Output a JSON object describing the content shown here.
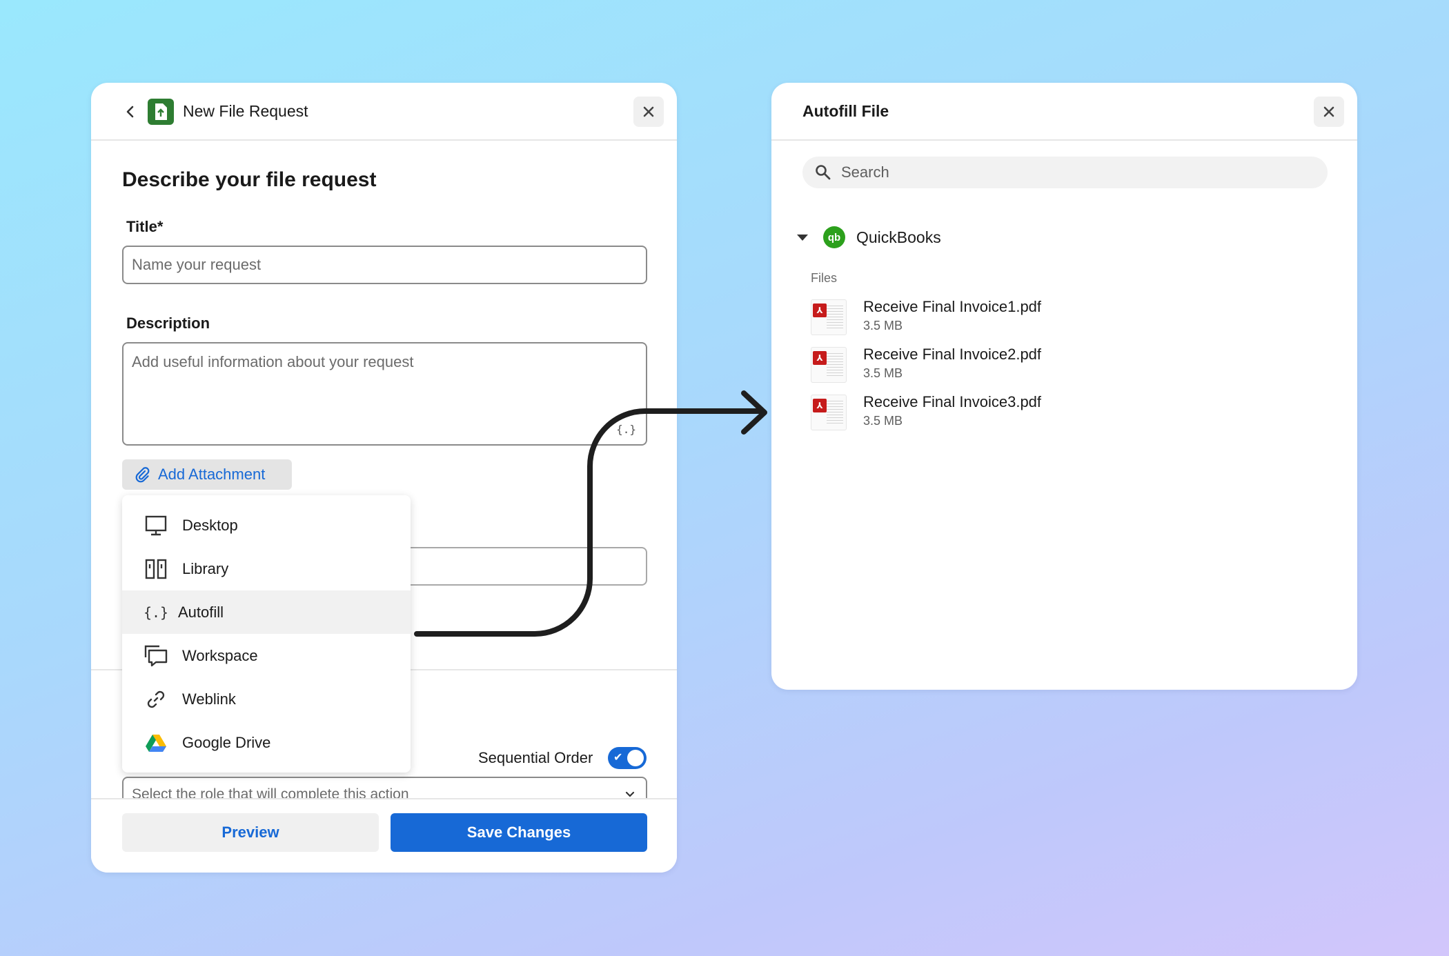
{
  "left_panel": {
    "header_title": "New File Request",
    "section_title": "Describe your file request",
    "title_label": "Title*",
    "title_placeholder": "Name your request",
    "description_label": "Description",
    "description_placeholder": "Add useful information about your request",
    "autofill_marker": "{.}",
    "add_attachment_label": "Add Attachment",
    "sequential_order_label": "Sequential Order",
    "sequential_order_on": true,
    "role_select_placeholder": "Select the role that will complete this action",
    "preview_label": "Preview",
    "save_label": "Save Changes"
  },
  "attachment_menu": {
    "items": [
      {
        "label": "Desktop",
        "icon": "monitor-icon"
      },
      {
        "label": "Library",
        "icon": "library-icon"
      },
      {
        "label": "Autofill",
        "icon": "autofill-braces-icon",
        "active": true
      },
      {
        "label": "Workspace",
        "icon": "workspace-icon"
      },
      {
        "label": "Weblink",
        "icon": "link-icon"
      },
      {
        "label": "Google Drive",
        "icon": "google-drive-icon"
      }
    ]
  },
  "right_panel": {
    "title": "Autofill File",
    "search_placeholder": "Search",
    "source_name": "QuickBooks",
    "source_logo_text": "qb",
    "files_label": "Files",
    "files": [
      {
        "name": "Receive Final Invoice1.pdf",
        "size": "3.5 MB"
      },
      {
        "name": "Receive Final Invoice2.pdf",
        "size": "3.5 MB"
      },
      {
        "name": "Receive Final Invoice3.pdf",
        "size": "3.5 MB"
      }
    ]
  },
  "colors": {
    "accent": "#1769d6",
    "app_logo": "#2e7d32",
    "quickbooks": "#2ca01c",
    "pdf_badge": "#c61b1b"
  }
}
